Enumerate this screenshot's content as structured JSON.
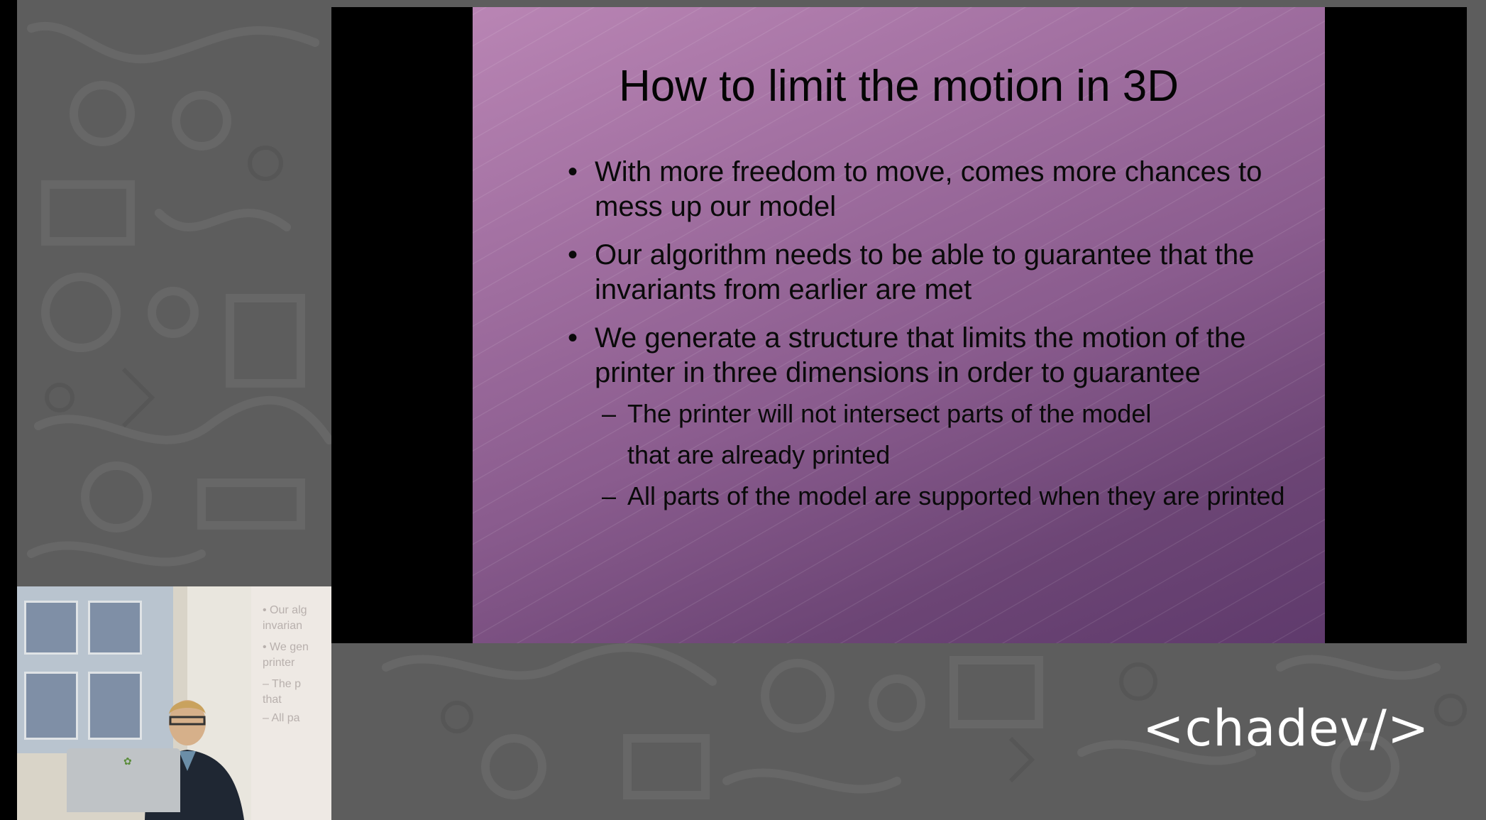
{
  "slide": {
    "title": "How to limit the motion in 3D",
    "bullets": [
      {
        "marker": "•",
        "text": "With more freedom to move, comes more chances to mess up our model"
      },
      {
        "marker": "•",
        "text": "Our algorithm needs to be able to guarantee that the invariants from earlier are met"
      },
      {
        "marker": "•",
        "text": "We generate a structure that limits the motion of the printer in three dimensions in order to guarantee"
      }
    ],
    "sub_bullets": [
      {
        "marker": "–",
        "line1": "The printer will not intersect parts of the model",
        "line2": "that are already printed"
      },
      {
        "marker": "–",
        "text": "All parts of the model are supported when they are printed"
      }
    ]
  },
  "webcam": {
    "screen_fragments": [
      "• Our alg",
      "invarian",
      "• We gen",
      "printer",
      "– The p",
      "that",
      "– All pa"
    ]
  },
  "logo": {
    "text": "<chadev/>"
  },
  "colors": {
    "backdrop": "#5d5d5d",
    "slide_top": "#b985b4",
    "slide_bottom": "#5f3a6c",
    "text": "#0a0a0a"
  }
}
